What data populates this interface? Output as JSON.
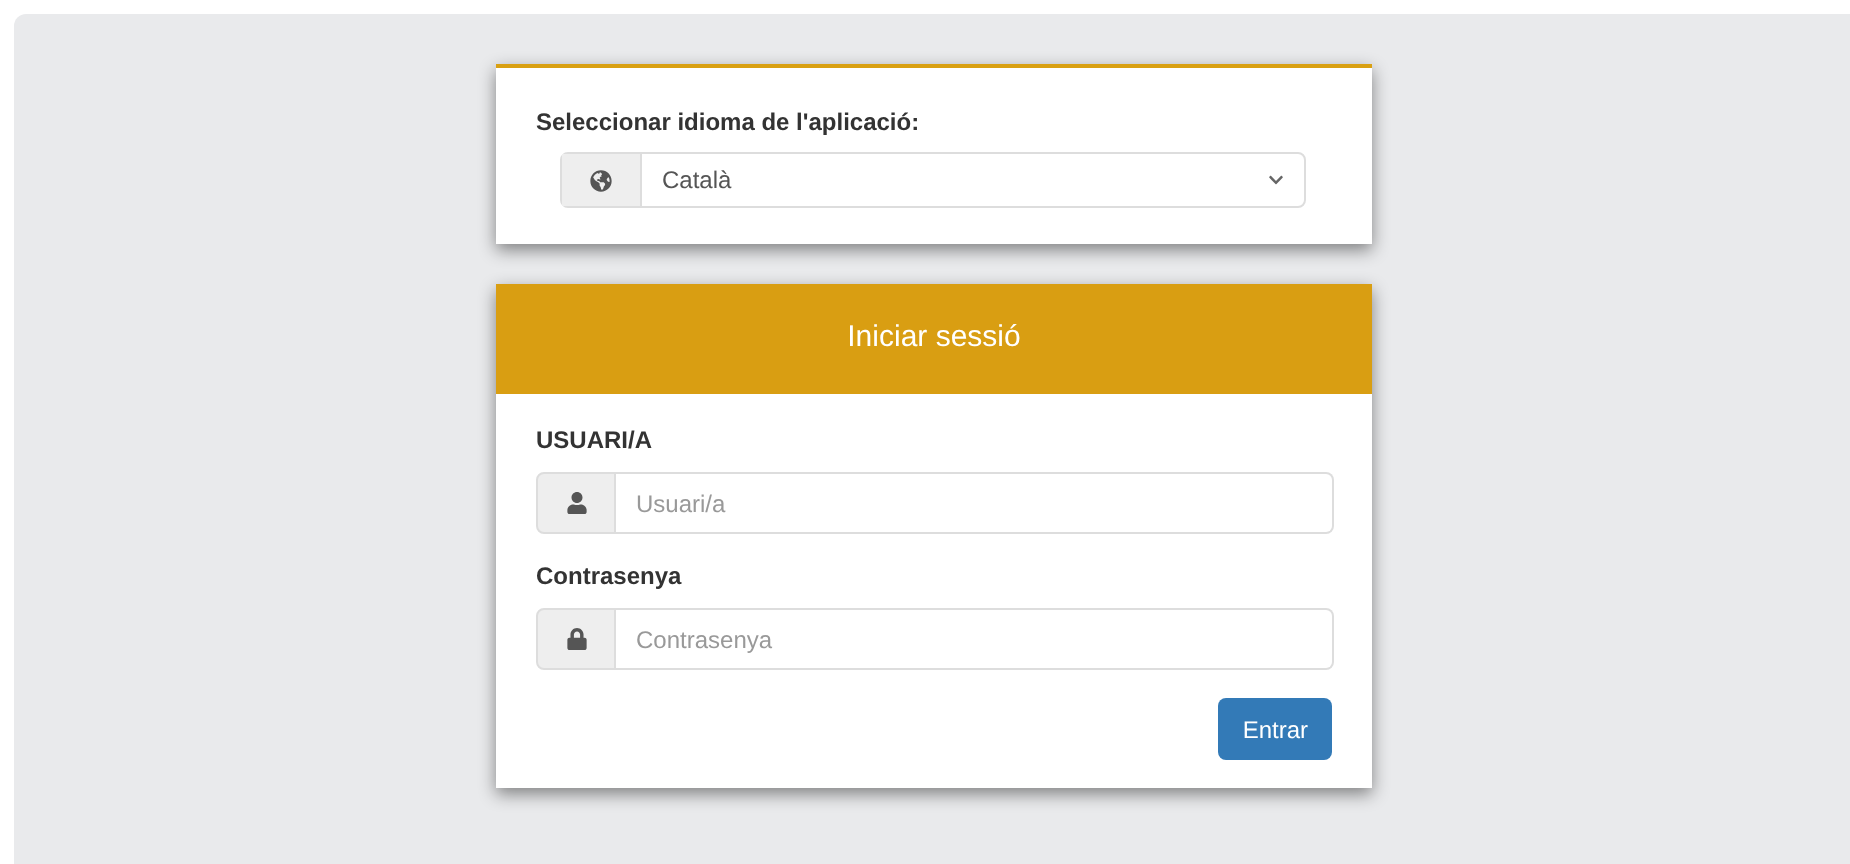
{
  "language_card": {
    "label": "Seleccionar idioma de l'aplicació:",
    "select": {
      "value": "Català"
    }
  },
  "login_card": {
    "title": "Iniciar sessió",
    "fields": [
      {
        "label": "USUARI/A",
        "placeholder": "Usuari/a"
      },
      {
        "label": "Contrasenya",
        "placeholder": "Contrasenya"
      }
    ],
    "button": "Entrar"
  }
}
